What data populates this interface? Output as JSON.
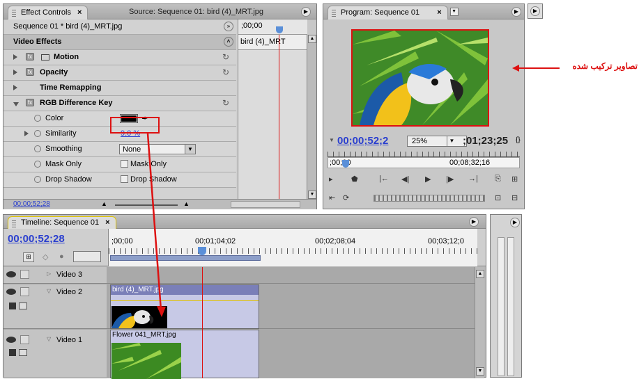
{
  "effect_controls": {
    "tab_label": "Effect Controls",
    "tab_close": "×",
    "source_tab_label": "Source: Sequence 01: bird (4)_MRT.jpg",
    "sequence_label": "Sequence 01 * bird (4)_MRT.jpg",
    "timecode_top": ";00;00",
    "clip_label": "bird (4)_MRT",
    "video_effects_label": "Video Effects",
    "effects": [
      {
        "name": "Motion"
      },
      {
        "name": "Opacity"
      },
      {
        "name": "Time Remapping"
      },
      {
        "name": "RGB Difference Key"
      }
    ],
    "props": {
      "color_label": "Color",
      "similarity_label": "Similarity",
      "similarity_value": "9.0 %",
      "smoothing_label": "Smoothing",
      "smoothing_value": "None",
      "mask_only_label": "Mask Only",
      "mask_only_check": "Mask Only",
      "drop_shadow_label": "Drop Shadow",
      "drop_shadow_check": "Drop Shadow"
    },
    "bottom_timecode": "00;00;52;28",
    "key_color": "#000000"
  },
  "program": {
    "tab_label": "Program: Sequence 01",
    "tab_close": "×",
    "current_timecode": "00;00;52;2",
    "zoom": "25%",
    "duration": ";01;23;25",
    "ruler_start": ";00;00",
    "ruler_end": "00;08;32;16"
  },
  "annotation": {
    "text": "تصاویر ترکیب شده"
  },
  "timeline": {
    "tab_label": "Timeline: Sequence 01",
    "tab_close": "×",
    "current_timecode": "00;00;52;28",
    "ruler_labels": [
      ";00;00",
      "00;01;04;02",
      "00;02;08;04",
      "00;03;12;0"
    ],
    "tracks": [
      {
        "name": "Video 3"
      },
      {
        "name": "Video 2",
        "clip": "bird (4)_MRT.jpg"
      },
      {
        "name": "Video 1",
        "clip": "Flower 041_MRT.jpg"
      }
    ]
  },
  "colors": {
    "accent_red": "#dd1111",
    "link_blue": "#2a3fcf",
    "panel_bg": "#c8c8c8"
  }
}
